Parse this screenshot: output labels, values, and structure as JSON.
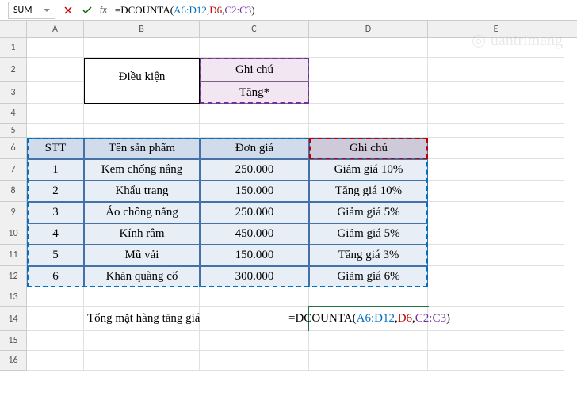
{
  "name_box": "SUM",
  "formula_text": "=DCOUNTA(A6:D12,D6,C2:C3)",
  "formula_parts": {
    "p1": "=DCOUNTA(",
    "r1": "A6:D12",
    "c1": ",",
    "r2": "D6",
    "c2": ",",
    "r3": "C2:C3",
    "p2": ")"
  },
  "columns": [
    "A",
    "B",
    "C",
    "D",
    "E"
  ],
  "rows": [
    "1",
    "2",
    "3",
    "4",
    "5",
    "6",
    "7",
    "8",
    "9",
    "10",
    "11",
    "12",
    "13",
    "14",
    "15",
    "16"
  ],
  "criteria": {
    "label": "Điều kiện",
    "header": "Ghi chú",
    "value": "Tăng*"
  },
  "table": {
    "headers": {
      "stt": "STT",
      "ten": "Tên sản phẩm",
      "gia": "Đơn giá",
      "ghichu": "Ghi chú"
    },
    "rows": [
      {
        "stt": "1",
        "ten": "Kem chống nắng",
        "gia": "250.000",
        "ghichu": "Giảm giá 10%"
      },
      {
        "stt": "2",
        "ten": "Khẩu trang",
        "gia": "150.000",
        "ghichu": "Tăng giá 10%"
      },
      {
        "stt": "3",
        "ten": "Áo chống nắng",
        "gia": "250.000",
        "ghichu": "Giảm giá 5%"
      },
      {
        "stt": "4",
        "ten": "Kính râm",
        "gia": "450.000",
        "ghichu": "Giảm giá 5%"
      },
      {
        "stt": "5",
        "ten": "Mũ vải",
        "gia": "150.000",
        "ghichu": "Tăng giá 3%"
      },
      {
        "stt": "6",
        "ten": "Khăn quàng cổ",
        "gia": "300.000",
        "ghichu": "Giảm giá 6%"
      }
    ]
  },
  "summary_label": "Tổng mặt hàng tăng giá bán",
  "watermark": "uantrimang"
}
